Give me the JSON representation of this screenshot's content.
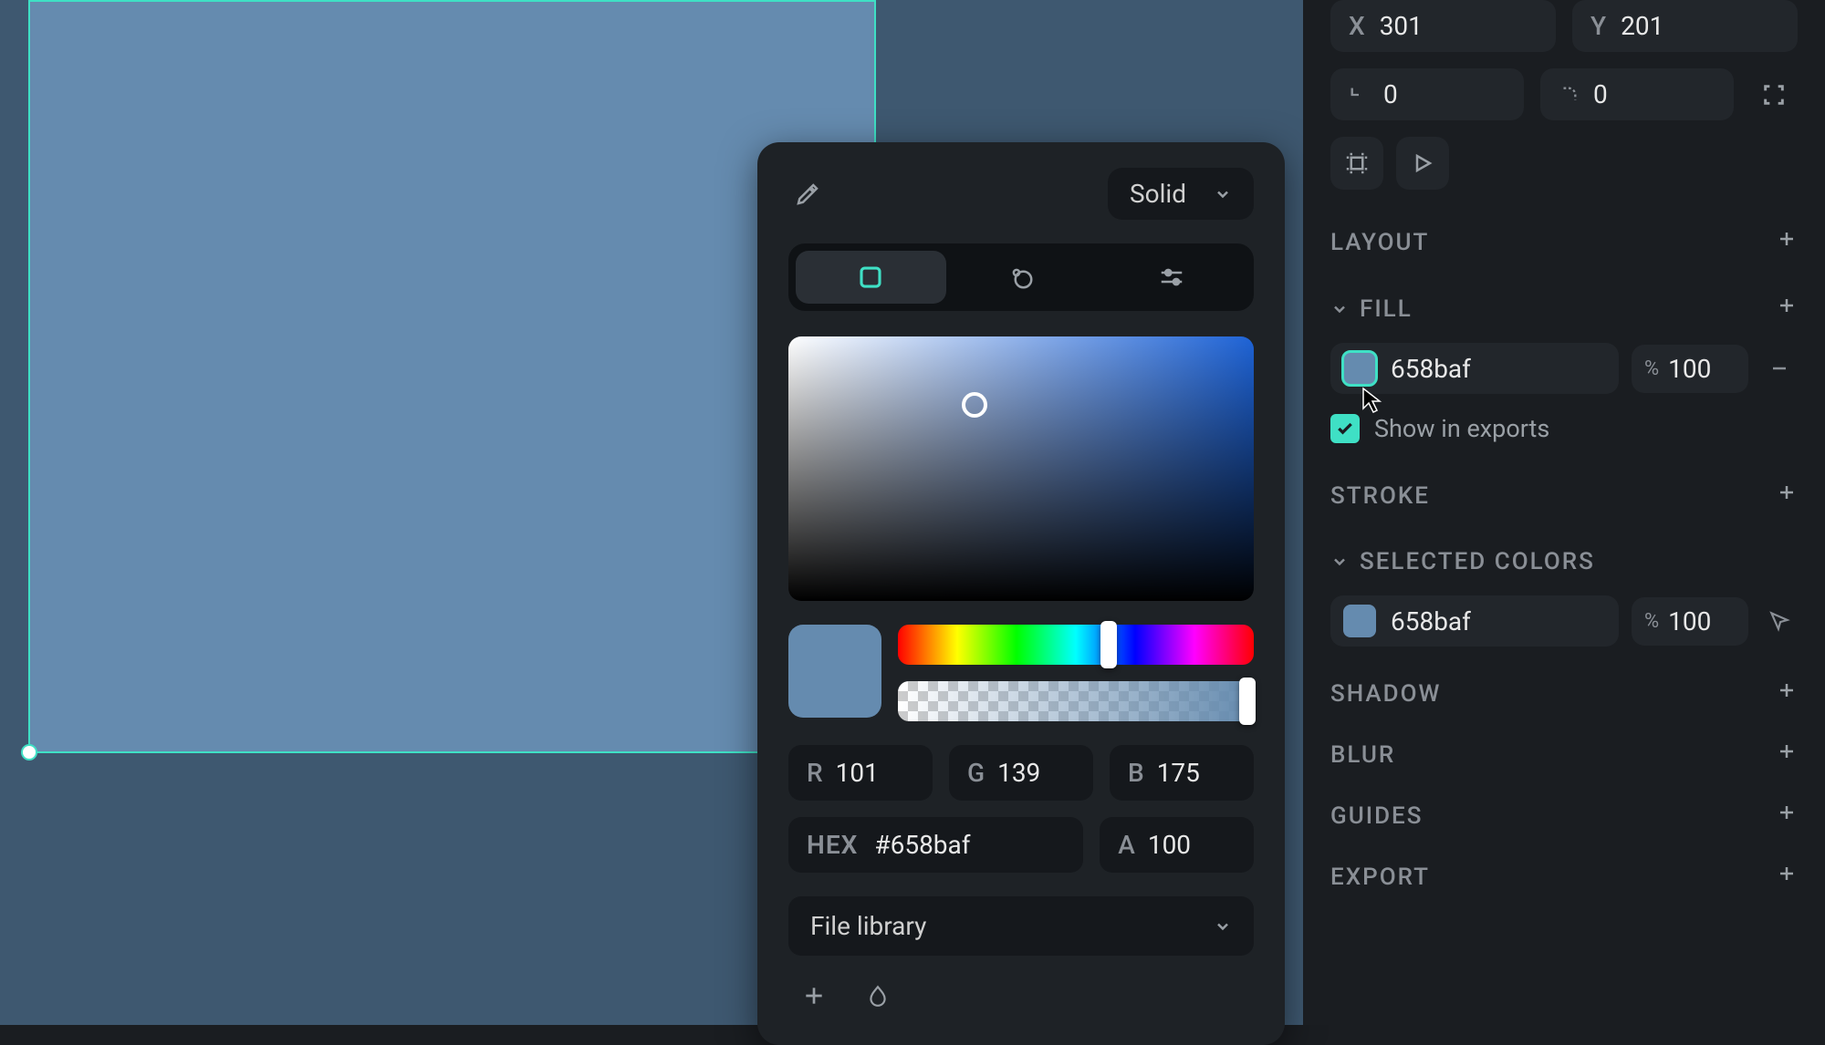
{
  "canvas": {
    "fill_color": "#658baf",
    "bg_color": "#3e5870",
    "accent": "#3fe0c5"
  },
  "color_picker": {
    "fill_type": "Solid",
    "rgb": {
      "r_label": "R",
      "r": "101",
      "g_label": "G",
      "g": "139",
      "b_label": "B",
      "b": "175"
    },
    "hex_label": "HEX",
    "hex": "#658baf",
    "alpha_label": "A",
    "alpha": "100",
    "library": "File library"
  },
  "sidebar": {
    "x_label": "X",
    "x": "301",
    "y_label": "Y",
    "y": "201",
    "rotation": "0",
    "corner_radius": "0",
    "sections": {
      "layout": "LAYOUT",
      "fill": "FILL",
      "stroke": "STROKE",
      "selected_colors": "SELECTED COLORS",
      "shadow": "SHADOW",
      "blur": "BLUR",
      "guides": "GUIDES",
      "export": "EXPORT"
    },
    "fill": {
      "hex": "658baf",
      "opacity": "100",
      "pct_symbol": "%"
    },
    "show_in_exports": "Show in exports",
    "selected": {
      "hex": "658baf",
      "opacity": "100",
      "pct_symbol": "%"
    }
  }
}
